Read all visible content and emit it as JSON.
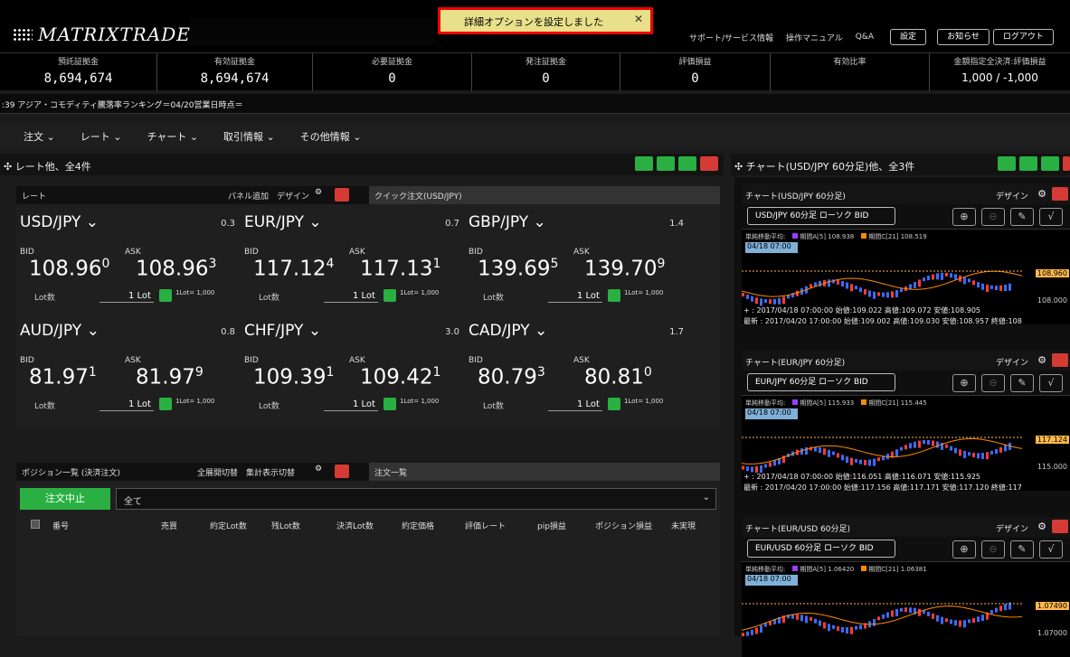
{
  "app": {
    "logo": "MATRIXTRADER",
    "notice": "詳細オプションを設定しました",
    "links": [
      "サポート/サービス情報",
      "操作マニュアル",
      "Q&A"
    ],
    "buttons": [
      "設定",
      "お知らせ",
      "ログアウト"
    ]
  },
  "stats": [
    {
      "label": "預託証拠金",
      "value": "8,694,674"
    },
    {
      "label": "有効証拠金",
      "value": "8,694,674"
    },
    {
      "label": "必要証拠金",
      "value": "0"
    },
    {
      "label": "発注証拠金",
      "value": "0"
    },
    {
      "label": "評価損益",
      "value": "0"
    },
    {
      "label": "有効比率",
      "value": ""
    },
    {
      "label": "金額指定全決済:評価損益",
      "value": "1,000 / -1,000"
    }
  ],
  "ticker": ":39 アジア・コモディティ騰落率ランキング＝04/20営業日時点＝",
  "menu": [
    "注文 ⌄",
    "レート ⌄",
    "チャート ⌄",
    "取引情報 ⌄",
    "その他情報 ⌄"
  ],
  "ratepanel": {
    "title": "✣ レート他、全4件",
    "head": "レート",
    "controls": "パネル追加　デザイン",
    "tab": "クイック注文(USD/JPY)"
  },
  "pairs": [
    {
      "name": "USD/JPY ⌄",
      "spread": "0.3",
      "bid": "108.96",
      "bidl": "0",
      "ask": "108.96",
      "askl": "3"
    },
    {
      "name": "EUR/JPY ⌄",
      "spread": "0.7",
      "bid": "117.12",
      "bidl": "4",
      "ask": "117.13",
      "askl": "1"
    },
    {
      "name": "GBP/JPY ⌄",
      "spread": "1.4",
      "bid": "139.69",
      "bidl": "5",
      "ask": "139.70",
      "askl": "9"
    },
    {
      "name": "AUD/JPY ⌄",
      "spread": "0.8",
      "bid": "81.97",
      "bidl": "1",
      "ask": "81.97",
      "askl": "9"
    },
    {
      "name": "CHF/JPY ⌄",
      "spread": "3.0",
      "bid": "109.39",
      "bidl": "1",
      "ask": "109.42",
      "askl": "1"
    },
    {
      "name": "CAD/JPY ⌄",
      "spread": "1.7",
      "bid": "80.79",
      "bidl": "3",
      "ask": "80.81",
      "askl": "0"
    }
  ],
  "labels": {
    "bid": "BID",
    "ask": "ASK",
    "lot": "Lot数",
    "lotv": "1 Lot",
    "lotu": "1Lot=\n1,000"
  },
  "positions": {
    "title": "ポジション一覧 (決済注文)",
    "controls": "全展開切替　集計表示切替",
    "tab": "注文一覧",
    "stop": "注文中止",
    "filter": "全て",
    "cols": [
      "番号",
      "売買",
      "約定Lot数",
      "残Lot数",
      "決済Lot数",
      "約定価格",
      "評価レート",
      "pip損益",
      "ポジション損益",
      "未実現"
    ]
  },
  "charts": {
    "title": "✣ チャート(USD/JPY 60分足)他、全3件",
    "items": [
      {
        "title": "チャート(USD/JPY 60分足)",
        "pill": "USD/JPY 60分足 ローソク BID",
        "ma": "単純移動平均:",
        "maA": "期間A[5] 108.938",
        "maC": "期間C[21] 108.519",
        "date": "04/18 07:00",
        "price": "108.960",
        "axis": "108.000",
        "info1": "+ : 2017/04/18 07:00:00 始値:109.022 高値:109.072 安値:108.905",
        "info2": "最新 : 2017/04/20 17:00:00 始値:109.002 高値:109.030 安値:108.957 終値:108"
      },
      {
        "title": "チャート(EUR/JPY 60分足)",
        "pill": "EUR/JPY 60分足 ローソク BID",
        "ma": "単純移動平均:",
        "maA": "期間A[5] 115.933",
        "maC": "期間C[21] 115.445",
        "date": "04/18 07:00",
        "price": "117.124",
        "axis": "115.000",
        "info1": "+ : 2017/04/18 07:00:00 始値:116.051 高値:116.071 安値:115.925",
        "info2": "最新 : 2017/04/20 17:00:00 始値:117.156 高値:117.171 安値:117.120 終値:117"
      },
      {
        "title": "チャート(EUR/USD 60分足)",
        "pill": "EUR/USD 60分足 ローソク BID",
        "ma": "単純移動平均:",
        "maA": "期間A[5] 1.06420",
        "maC": "期間C[21] 1.06381",
        "date": "04/18 07:00",
        "price": "1.07490",
        "axis": "1.07000",
        "info1": "",
        "info2": ""
      }
    ]
  },
  "design": "デザイン"
}
